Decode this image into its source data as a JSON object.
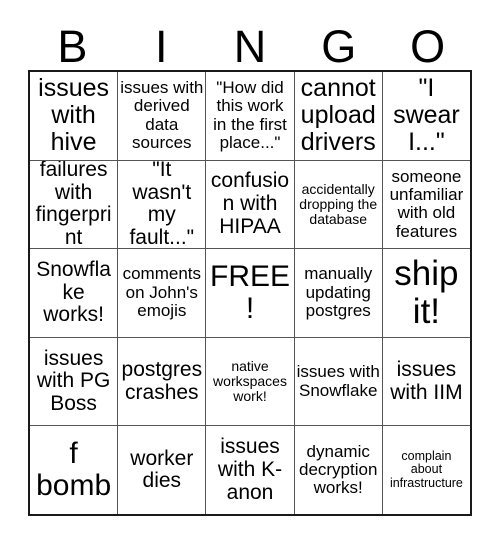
{
  "card": {
    "header_letters": [
      "B",
      "I",
      "N",
      "G",
      "O"
    ],
    "columns": 5,
    "rows": 5,
    "border_color": "#1a1a1a",
    "grid_line_color": "#555555",
    "background_color": "#ffffff",
    "text_color": "#000000",
    "cells": [
      [
        {
          "text": "issues with hive",
          "size": "lg"
        },
        {
          "text": "issues with derived data sources",
          "size": "sm"
        },
        {
          "text": "\"How did this work in the first place...\"",
          "size": "sm"
        },
        {
          "text": "cannot upload drivers",
          "size": "lg"
        },
        {
          "text": "\"I swear I...\"",
          "size": "lg"
        }
      ],
      [
        {
          "text": "failures with fingerprint",
          "size": "md"
        },
        {
          "text": "\"It wasn't my fault...\"",
          "size": "md"
        },
        {
          "text": "confusion with HIPAA",
          "size": "md"
        },
        {
          "text": "accidentally dropping the database",
          "size": "xs"
        },
        {
          "text": "someone unfamiliar with old features",
          "size": "sm"
        }
      ],
      [
        {
          "text": "Snowflake works!",
          "size": "md"
        },
        {
          "text": "comments on John's emojis",
          "size": "sm"
        },
        {
          "text": "FREE!",
          "size": "xl"
        },
        {
          "text": "manually updating postgres",
          "size": "sm"
        },
        {
          "text": "ship it!",
          "size": "xxl"
        }
      ],
      [
        {
          "text": "issues with PG Boss",
          "size": "md"
        },
        {
          "text": "postgres crashes",
          "size": "md"
        },
        {
          "text": "native workspaces work!",
          "size": "xs"
        },
        {
          "text": "issues with Snowflake",
          "size": "sm"
        },
        {
          "text": "issues with IIM",
          "size": "md"
        }
      ],
      [
        {
          "text": "f bomb",
          "size": "xl"
        },
        {
          "text": "worker dies",
          "size": "md"
        },
        {
          "text": "issues with K-anon",
          "size": "md"
        },
        {
          "text": "dynamic decryption works!",
          "size": "sm"
        },
        {
          "text": "complain about infrastructure",
          "size": "xxs"
        }
      ]
    ]
  }
}
